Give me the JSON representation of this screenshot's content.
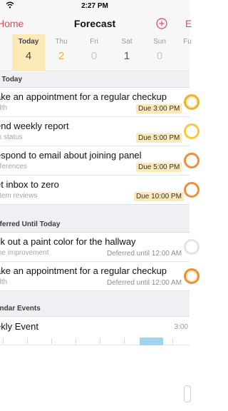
{
  "status_bar": {
    "time": "2:27 PM"
  },
  "nav": {
    "back_label": "Home",
    "title": "Forecast",
    "edit_label": "E"
  },
  "day_strip": [
    {
      "name": "t",
      "count": ""
    },
    {
      "name": "Today",
      "count": "4"
    },
    {
      "name": "Thu",
      "count": "2"
    },
    {
      "name": "Fri",
      "count": "0"
    },
    {
      "name": "Sat",
      "count": "1"
    },
    {
      "name": "Sun",
      "count": "0"
    },
    {
      "name": "Fu",
      "count": ""
    }
  ],
  "sections": {
    "due_today": "e Today",
    "deferred": "eferred Until Today",
    "calendar": "endar Events"
  },
  "due_tasks": [
    {
      "title": "ake an appointment for a regular checkup",
      "context": "alth",
      "due": "Due 3:00 PM"
    },
    {
      "title": "end weekly report",
      "context": "rk status",
      "due": "Due 5:00 PM"
    },
    {
      "title": "espond to email about joining panel",
      "context": "nferences",
      "due": "Due 5:00 PM"
    },
    {
      "title": "et inbox to zero",
      "context": "stem reviews",
      "due": "Due 10:00 PM"
    }
  ],
  "deferred_tasks": [
    {
      "title": "ck out a paint color for the hallway",
      "context": "me improvement",
      "deferred": "Deferred until 12:00 AM"
    },
    {
      "title": "ake an appointment for a regular checkup",
      "context": "alth",
      "deferred": "Deferred until 12:00 AM"
    }
  ],
  "calendar_events": [
    {
      "title": "ekly Event",
      "time": "3:00"
    }
  ],
  "colors": {
    "accent": "#e8485a",
    "due_highlight": "#fbe9b7",
    "amber": "#f1b031",
    "event_bar": "#9fd3f0"
  }
}
